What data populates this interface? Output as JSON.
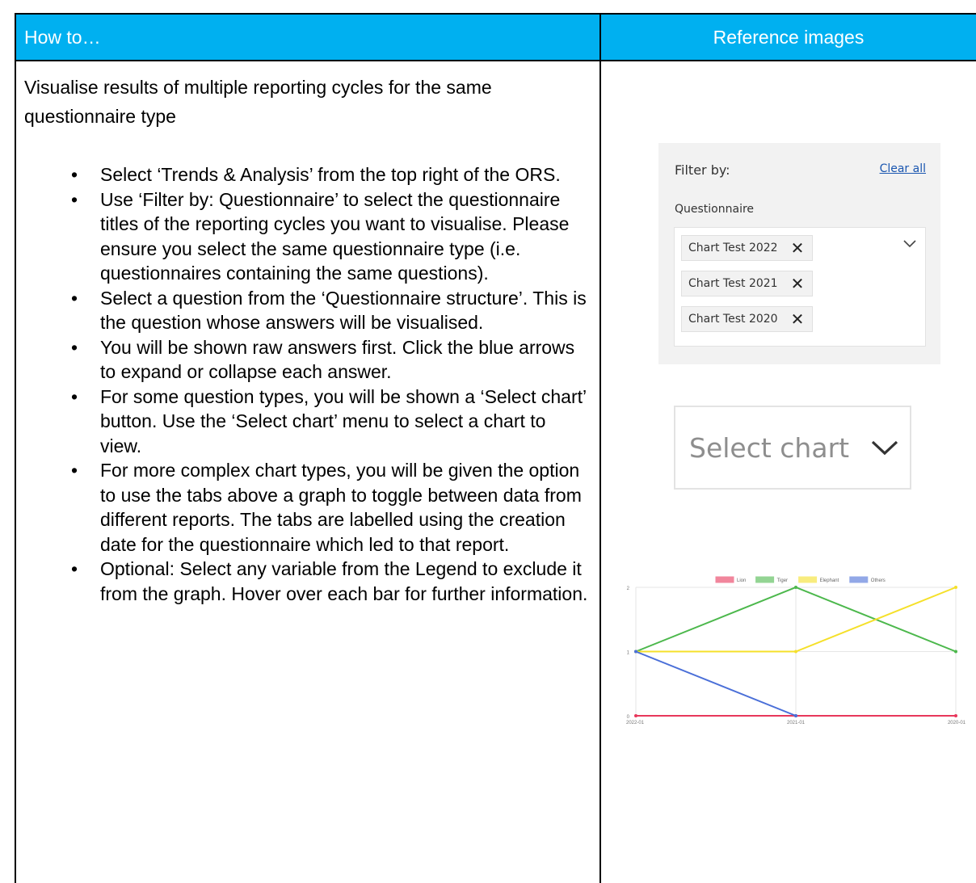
{
  "header": {
    "left": "How to…",
    "right": "Reference images"
  },
  "section": {
    "title": "Visualise results of multiple reporting cycles for the same questionnaire type",
    "bullets": [
      "Select ‘Trends & Analysis’ from the top right of the ORS.",
      "Use ‘Filter by: Questionnaire’ to select the questionnaire titles of the reporting cycles you want to visualise. Please ensure you select the same questionnaire type (i.e. questionnaires containing the same questions).",
      "Select a question from the ‘Questionnaire structure’. This is the question whose answers will be visualised.",
      "You will be shown raw answers first. Click the blue arrows to expand or collapse each answer.",
      "For some question types, you will be shown a ‘Select chart’ button. Use the ‘Select chart’ menu to select a chart to view.",
      "For more complex chart types, you will be given the option to use the tabs above a graph to toggle between data from different reports. The tabs are labelled using the creation date for the questionnaire which led to that report.",
      "Optional: Select any variable from the Legend to exclude it from the graph. Hover over each bar for further information."
    ]
  },
  "filter": {
    "label": "Filter by:",
    "clear_all": "Clear all",
    "questionnaire_label": "Questionnaire",
    "tags": [
      "Chart Test 2022",
      "Chart Test 2021",
      "Chart Test 2020"
    ],
    "remove_icon": "close-icon",
    "dropdown_icon": "chevron-down-icon"
  },
  "select_chart": {
    "label": "Select chart",
    "icon": "chevron-down-icon"
  },
  "chart_data": {
    "type": "line",
    "x": [
      "2022-01",
      "2021-01",
      "2020-01"
    ],
    "series": [
      {
        "name": "Lion",
        "values": [
          0,
          0,
          0
        ],
        "color": "#e8375b"
      },
      {
        "name": "Tiger",
        "values": [
          1,
          2,
          1
        ],
        "color": "#4cb84c"
      },
      {
        "name": "Elephant",
        "values": [
          1,
          1,
          2
        ],
        "color": "#f5e02a"
      },
      {
        "name": "Others",
        "values": [
          1,
          0,
          null
        ],
        "color": "#4a6fd8"
      }
    ],
    "ylim": [
      0,
      2
    ],
    "yticks": [
      "0",
      "1",
      "2"
    ],
    "grid": true,
    "legend": "top"
  }
}
